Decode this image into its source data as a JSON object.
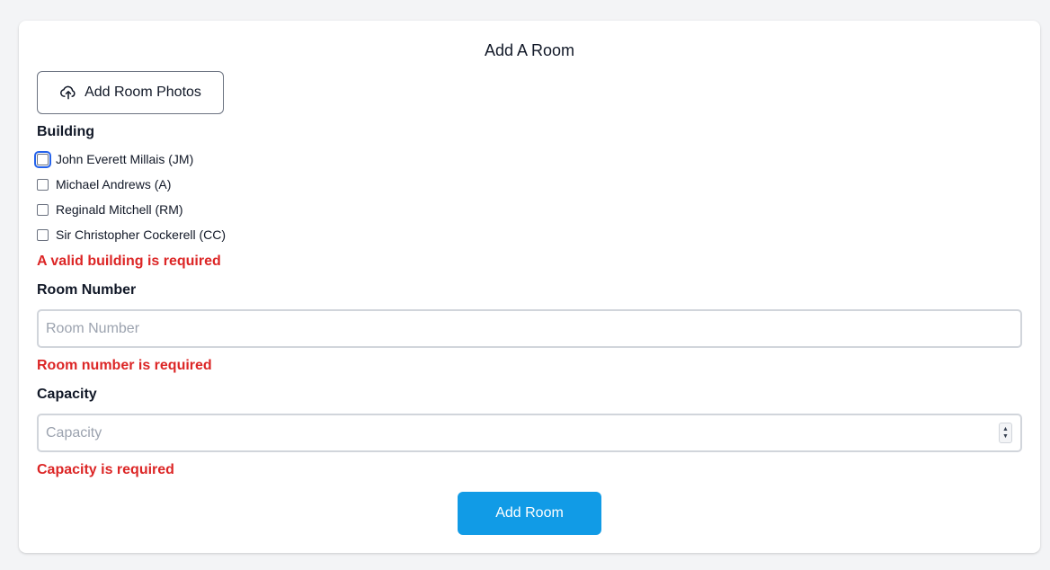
{
  "form": {
    "title": "Add A Room",
    "photo_button_label": "Add Room Photos",
    "building_label": "Building",
    "buildings": [
      {
        "label": "John Everett Millais (JM)",
        "checked": false
      },
      {
        "label": "Michael Andrews (A)",
        "checked": false
      },
      {
        "label": "Reginald Mitchell (RM)",
        "checked": false
      },
      {
        "label": "Sir Christopher Cockerell (CC)",
        "checked": false
      }
    ],
    "building_error": "A valid building is required",
    "room_number_label": "Room Number",
    "room_number_placeholder": "Room Number",
    "room_number_value": "",
    "room_number_error": "Room number is required",
    "capacity_label": "Capacity",
    "capacity_placeholder": "Capacity",
    "capacity_value": "",
    "capacity_error": "Capacity is required",
    "submit_label": "Add Room"
  },
  "icons": {
    "photo_button_icon": "cloud-upload-icon",
    "spinner_up": "chevron-up-icon",
    "spinner_down": "chevron-down-icon"
  },
  "colors": {
    "error": "#dc2626",
    "primary_button": "#119be6",
    "focus_outline": "#2563eb",
    "background": "#f3f4f6"
  }
}
